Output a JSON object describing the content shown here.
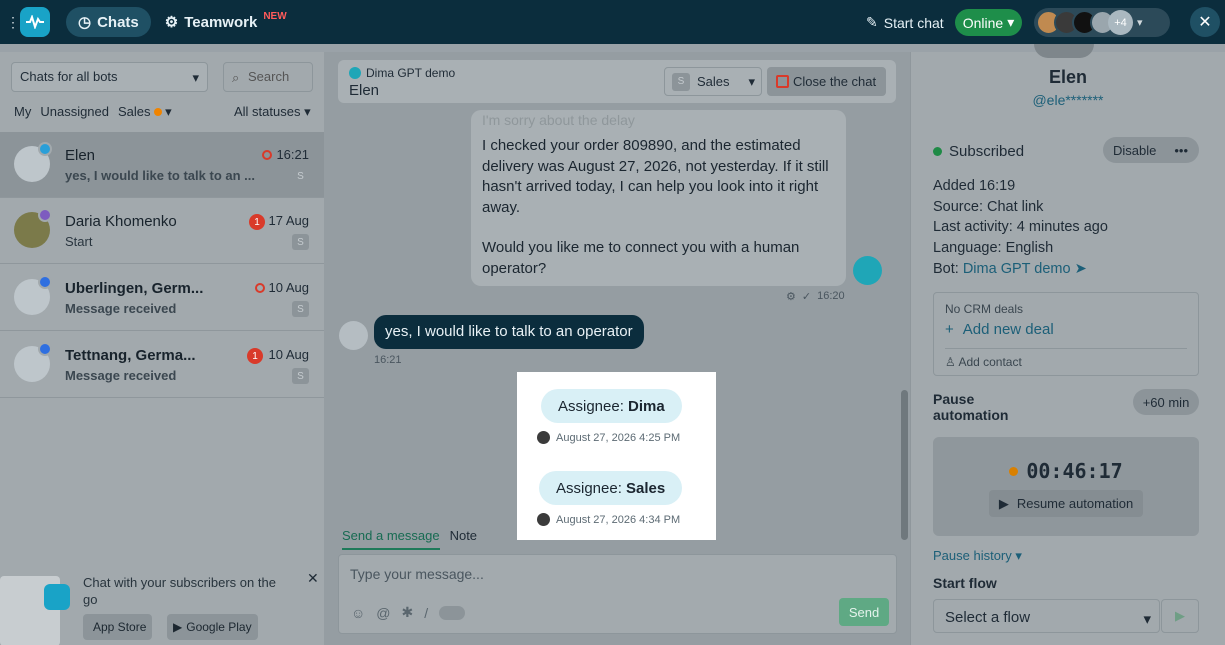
{
  "topbar": {
    "nav": [
      {
        "label": "Chats"
      },
      {
        "label": "Teamwork",
        "badge": "NEW"
      }
    ],
    "start_chat": "Start chat",
    "status": "Online",
    "avatars_more": "+4"
  },
  "sidebar": {
    "bots_filter": "Chats for all bots",
    "search_placeholder": "Search",
    "filters": [
      "My",
      "Unassigned",
      "Sales"
    ],
    "statuses": "All statuses",
    "chats": [
      {
        "name": "Elen",
        "time": "16:21",
        "preview": "yes, I would like to talk to an ...",
        "chip": "S",
        "channel": "telegram"
      },
      {
        "name": "Daria Khomenko",
        "time": "17 Aug",
        "preview": "Start",
        "unread": "1",
        "chip": "S",
        "channel": "viber"
      },
      {
        "name": "Uberlingen, Germ...",
        "time": "10 Aug",
        "preview": "Message received",
        "chip": "S",
        "channel": "messenger"
      },
      {
        "name": "Tettnang, Germa...",
        "time": "10 Aug",
        "preview": "Message received",
        "unread": "1",
        "chip": "S",
        "channel": "messenger"
      }
    ],
    "promo": {
      "text": "Chat with your subscribers on the go",
      "app_store": "App Store",
      "google_play": "Google Play"
    }
  },
  "chat": {
    "bot_name": "Dima GPT demo",
    "contact": "Elen",
    "department": "Sales",
    "department_chip": "S",
    "close_label": "Close the chat",
    "bot_message_faded": "I'm sorry about the delay",
    "bot_message_p1": "I checked your order 809890, and the estimated delivery was August 27, 2026, not yesterday. If it still hasn't arrived today, I can help you look into it right away.",
    "bot_message_p2": "Would you like me to connect you with a human operator?",
    "bot_time": "16:20",
    "user_message": "yes, I would like to talk to an operator",
    "user_time": "16:21",
    "events": [
      {
        "label": "Assignee:",
        "value": "Dima",
        "meta": "August 27, 2026 4:25 PM"
      },
      {
        "label": "Assignee:",
        "value": "Sales",
        "meta": "August 27, 2026 4:34 PM"
      }
    ],
    "composer": {
      "tab_message": "Send a message",
      "tab_note": "Note",
      "placeholder": "Type your message...",
      "send": "Send"
    }
  },
  "profile": {
    "name": "Elen",
    "handle": "@ele*******",
    "subscription": "Subscribed",
    "disable": "Disable",
    "added": "Added 16:19",
    "source": "Source: Chat link",
    "last_activity": "Last activity: 4 minutes ago",
    "language": "Language: English",
    "bot_label": "Bot:",
    "bot_name": "Dima GPT demo",
    "crm_empty": "No CRM deals",
    "add_deal": "Add new deal",
    "add_contact": "Add contact",
    "pause_title": "Pause automation",
    "plus_time": "+60 min",
    "timer": "00:46:17",
    "resume": "Resume automation",
    "pause_history": "Pause history",
    "start_flow": "Start flow",
    "flow_placeholder": "Select a flow"
  },
  "colors": {
    "topbar": "#0b2d3d",
    "accent": "#19a3c7",
    "online": "#1e8e4a",
    "unread": "#d93a2a",
    "send": "#5fa984",
    "user_bubble": "#0b2d3d"
  }
}
